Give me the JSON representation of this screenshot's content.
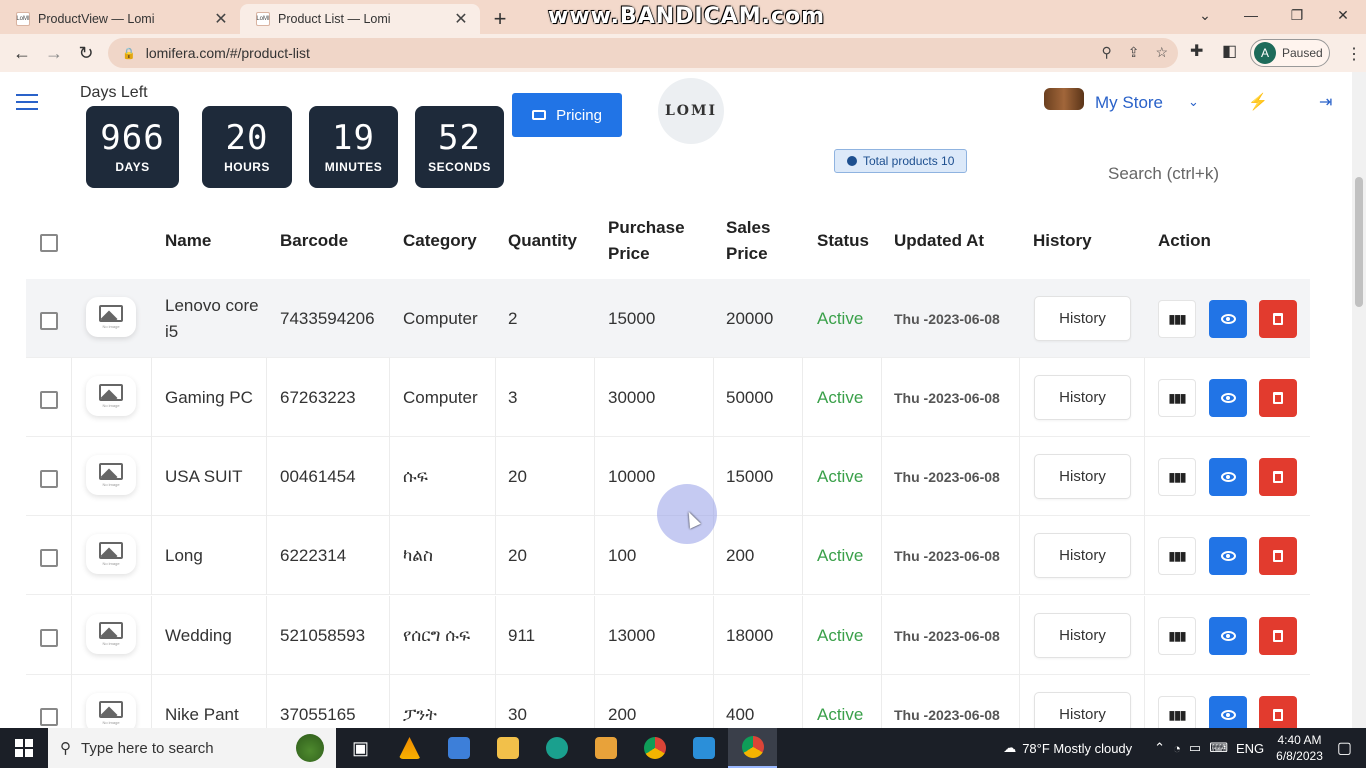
{
  "browser": {
    "tabs": [
      {
        "label": "ProductView — Lomi",
        "active": false
      },
      {
        "label": "Product List — Lomi",
        "active": true
      }
    ],
    "favicon_text": "LoMI",
    "watermark": "www.BANDICAM.com",
    "url": "lomifera.com/#/product-list",
    "profile_initial": "A",
    "profile_status": "Paused"
  },
  "header": {
    "days_left_label": "Days Left",
    "countdown": [
      {
        "value": "966",
        "label": "DAYS"
      },
      {
        "value": "20",
        "label": "HOURS"
      },
      {
        "value": "19",
        "label": "MINUTES"
      },
      {
        "value": "52",
        "label": "SECONDS"
      }
    ],
    "pricing_label": "Pricing",
    "logo_text": "LOMI",
    "store_label": "My Store"
  },
  "toolbar": {
    "total_products": "Total products 10",
    "search_placeholder": "Search (ctrl+k)"
  },
  "table": {
    "columns": [
      "Name",
      "Barcode",
      "Category",
      "Quantity",
      "Purchase Price",
      "Sales Price",
      "Status",
      "Updated At",
      "History",
      "Action"
    ],
    "history_label": "History",
    "image_caption": "No image",
    "rows": [
      {
        "name": "Lenovo core i5",
        "barcode": "7433594206",
        "category": "Computer",
        "quantity": "2",
        "purchase": "15000",
        "sales": "20000",
        "status": "Active",
        "updated": "Thu -2023-06-08"
      },
      {
        "name": "Gaming PC",
        "barcode": "67263223",
        "category": "Computer",
        "quantity": "3",
        "purchase": "30000",
        "sales": "50000",
        "status": "Active",
        "updated": "Thu -2023-06-08"
      },
      {
        "name": "USA SUIT",
        "barcode": "00461454",
        "category": "ሱፍ",
        "quantity": "20",
        "purchase": "10000",
        "sales": "15000",
        "status": "Active",
        "updated": "Thu -2023-06-08"
      },
      {
        "name": "Long",
        "barcode": "6222314",
        "category": "ካልስ",
        "quantity": "20",
        "purchase": "100",
        "sales": "200",
        "status": "Active",
        "updated": "Thu -2023-06-08"
      },
      {
        "name": "Wedding",
        "barcode": "521058593",
        "category": "የሰርግ ሱፍ",
        "quantity": "911",
        "purchase": "13000",
        "sales": "18000",
        "status": "Active",
        "updated": "Thu -2023-06-08"
      },
      {
        "name": "Nike Pant",
        "barcode": "37055165",
        "category": "ፓንት",
        "quantity": "30",
        "purchase": "200",
        "sales": "400",
        "status": "Active",
        "updated": "Thu -2023-06-08"
      }
    ]
  },
  "taskbar": {
    "search_placeholder": "Type here to search",
    "weather": "78°F  Mostly cloudy",
    "lang": "ENG",
    "time": "4:40 AM",
    "date": "6/8/2023"
  },
  "colors": {
    "primary": "#2174e6",
    "danger": "#e23b2e",
    "active_status": "#3aa04a",
    "countdown_bg": "#1e2a3a"
  }
}
